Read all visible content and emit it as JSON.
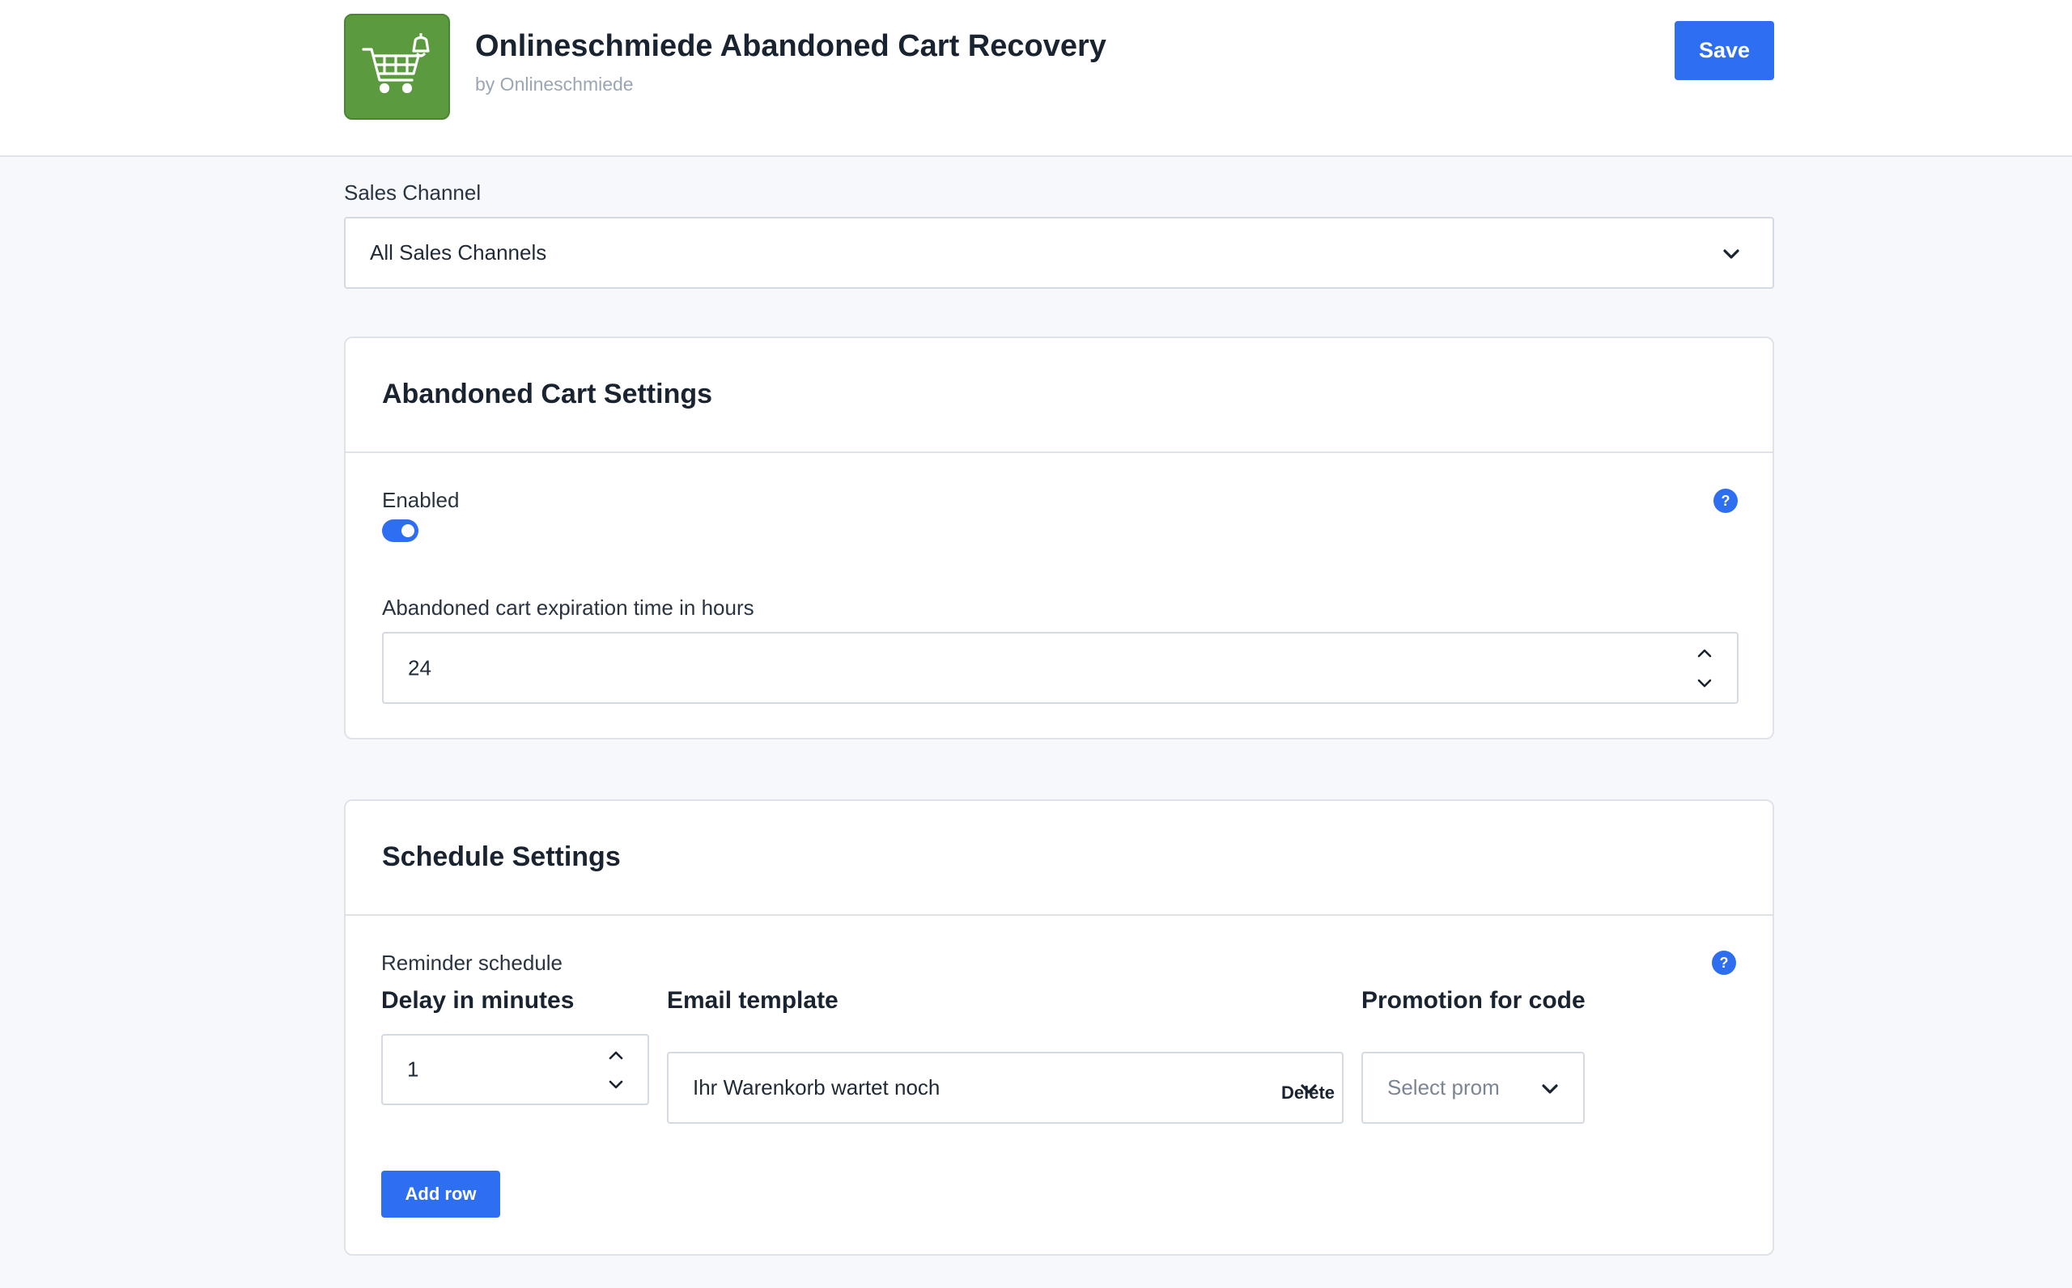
{
  "header": {
    "app_title": "Onlineschmiede Abandoned Cart Recovery",
    "byline": "by Onlineschmiede",
    "logo_icon": "shopping-cart-with-bell-icon",
    "logo_color": "#5b9a3e",
    "save_label": "Save"
  },
  "sales_channel": {
    "label": "Sales Channel",
    "selected": "All Sales Channels"
  },
  "abandoned_cart_settings": {
    "title": "Abandoned Cart Settings",
    "enabled_label": "Enabled",
    "enabled": true,
    "expiration_label": "Abandoned cart expiration time in hours",
    "expiration_value": "24",
    "help_icon": "?"
  },
  "schedule_settings": {
    "title": "Schedule Settings",
    "reminder_label": "Reminder schedule",
    "help_icon": "?",
    "columns": {
      "delay": "Delay in minutes",
      "template": "Email template",
      "promotion": "Promotion for code"
    },
    "rows": [
      {
        "delay": "1",
        "template": "Ihr Warenkorb wartet noch",
        "promotion_placeholder": "Select prom",
        "delete_label": "Delete"
      }
    ],
    "add_row_label": "Add row"
  },
  "colors": {
    "accent": "#2e6ef0",
    "background": "#f6f8fc",
    "border": "#dfe3e9"
  }
}
